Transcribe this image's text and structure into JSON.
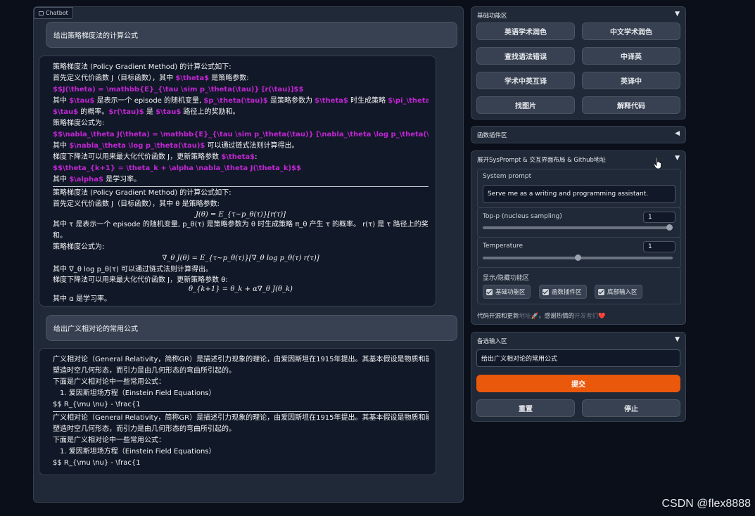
{
  "chatbot": {
    "tab_label": "Chatbot",
    "messages": [
      {
        "role": "user",
        "text": "给出策略梯度法的计算公式"
      },
      {
        "role": "bot"
      },
      {
        "role": "user",
        "text": "给出广义相对论的常用公式"
      },
      {
        "role": "bot"
      }
    ],
    "pg_raw": {
      "l1": "策略梯度法 (Policy Gradient Method) 的计算公式如下:",
      "l2a": "首先定义代价函数 J（目标函数），其中 ",
      "l2b": "$\\theta$",
      "l2c": " 是策略参数:",
      "l3": "$$J(\\theta) = \\mathbb{E}_{\\tau \\sim p_\\theta(\\tau)} [r(\\tau)]$$",
      "l4a": "其中 ",
      "l4b": "$\\tau$",
      "l4c": " 是表示一个 episode 的随机变量, ",
      "l4d": "$p_\\theta(\\tau)$",
      "l4e": " 是策略参数为 ",
      "l4f": "$\\theta$",
      "l4g": " 时生成策略 ",
      "l4h": "$\\pi_\\theta$",
      "l4i": " 产生",
      "l5a": "$\\tau$",
      "l5b": " 的概率。",
      "l5c": "$r(\\tau)$",
      "l5d": " 是 ",
      "l5e": "$\\tau$",
      "l5f": " 路径上的奖励和。",
      "l6": "策略梯度公式为:",
      "l7": "$$\\nabla_\\theta J(\\theta) = \\mathbb{E}_{\\tau \\sim p_\\theta(\\tau)} [\\nabla_\\theta \\log p_\\theta(\\tau) r(\\tau)]$$",
      "l8a": "其中 ",
      "l8b": "$\\nabla_\\theta \\log p_\\theta(\\tau)$",
      "l8c": " 可以通过链式法则计算得出。",
      "l9a": "梯度下降法可以用来最大化代价函数 J，更新策略参数 ",
      "l9b": "$\\theta$",
      "l9c": ":",
      "l10": "$$\\theta_{k+1} = \\theta_k + \\alpha \\nabla_\\theta J(\\theta_k)$$",
      "l11a": "其中 ",
      "l11b": "$\\alpha$",
      "l11c": " 是学习率。"
    },
    "pg_rendered": {
      "l1": "策略梯度法 (Policy Gradient Method) 的计算公式如下:",
      "l2": "首先定义代价函数 J（目标函数），其中 θ 是策略参数:",
      "eq1": "J(θ) = E_{τ~p_θ(τ)}[r(τ)]",
      "l3": "其中 τ 是表示一个 episode 的随机变量, p_θ(τ) 是策略参数为 θ 时生成策略 π_θ 产生 τ 的概率。 r(τ) 是 τ 路径上的奖励",
      "l4": "和。",
      "l5": "策略梯度公式为:",
      "eq2": "∇_θ J(θ) = E_{τ~p_θ(τ)}[∇_θ log p_θ(τ) r(τ)]",
      "l6": "其中 ∇_θ log p_θ(τ) 可以通过链式法则计算得出。",
      "l7": "梯度下降法可以用来最大化代价函数 J，更新策略参数 θ:",
      "eq3": "θ_{k+1} = θ_k + α∇_θ J(θ_k)",
      "l8": "其中 α 是学习率。"
    },
    "gr": {
      "l1": "广义相对论（General Relativity，简称GR）是描述引力现象的理论，由爱因斯坦在1915年提出。其基本假设是物质和能量",
      "l2": "塑造时空几何形态，而引力是由几何形态的弯曲所引起的。",
      "l3": "下面是广义相对论中一些常用公式：",
      "l4": "1. 爱因斯坦场方程（Einstein Field Equations）",
      "l5": "$$ R_{\\mu \\nu} - \\frac{1"
    }
  },
  "basic": {
    "title": "基础功能区",
    "caret": "▼",
    "buttons": [
      "英语学术润色",
      "中文学术润色",
      "查找语法错误",
      "中译英",
      "学术中英互译",
      "英译中",
      "找图片",
      "解释代码"
    ]
  },
  "plugin": {
    "title": "函数插件区",
    "caret": "◀"
  },
  "sysprompt": {
    "title": "展开SysPrompt & 交互界面布局 & Github地址",
    "caret": "▼",
    "system_prompt_label": "System prompt",
    "system_prompt_value": "Serve me as a writing and programming assistant.",
    "top_p_label": "Top-p (nucleus sampling)",
    "top_p_value": "1",
    "top_p_fraction": 1.0,
    "temperature_label": "Temperature",
    "temperature_value": "1",
    "temperature_fraction": 0.5,
    "toggle_label": "显示/隐藏功能区",
    "checkboxes": [
      "基础功能区",
      "函数插件区",
      "底部输入区"
    ],
    "footer_a": "代码开源和更新",
    "footer_link1": "地址",
    "footer_b": "🚀，感谢热情的",
    "footer_link2": "开发者们",
    "footer_heart": "❤️"
  },
  "input_area": {
    "title": "备选输入区",
    "caret": "▼",
    "value": "给出广义相对论的常用公式",
    "submit": "提交",
    "reset": "重置",
    "stop": "停止"
  },
  "watermark": "CSDN @flex8888",
  "colors": {
    "accent": "#ea580c",
    "tex": "#c026d3",
    "bg": "#0b0f19",
    "panel": "#1f2937"
  }
}
